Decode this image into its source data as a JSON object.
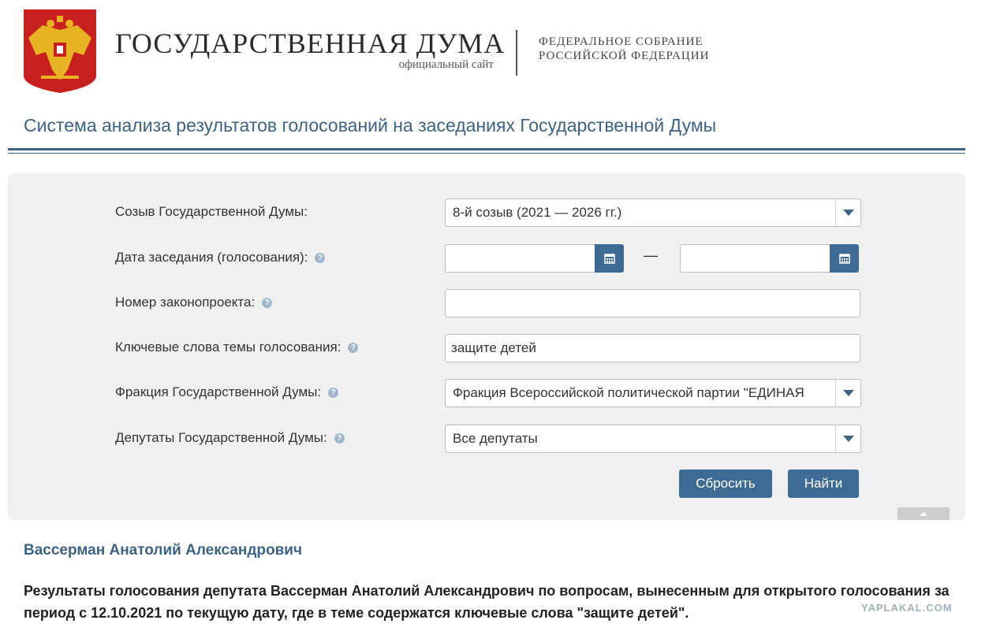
{
  "header": {
    "title": "ГОСУДАРСТВЕННАЯ ДУМА",
    "subtitle": "официальный сайт",
    "federal_line1": "ФЕДЕРАЛЬНОЕ СОБРАНИЕ",
    "federal_line2": "РОССИЙСКОЙ ФЕДЕРАЦИИ",
    "emblem_icon": "coat-of-arms-icon",
    "colors": {
      "emblem_red": "#c8201f",
      "eagle_gold": "#e6b422",
      "accent_blue": "#3e6383",
      "button_blue": "#3e6b94"
    }
  },
  "system_title": "Система анализа результатов голосований на заседаниях Государственной Думы",
  "form": {
    "convocation": {
      "label": "Созыв Государственной Думы:",
      "value": "8-й созыв (2021 — 2026 гг.)"
    },
    "session_date": {
      "label": "Дата заседания (голосования):",
      "from": "",
      "to": "",
      "separator": "—"
    },
    "bill_number": {
      "label": "Номер законопроекта:",
      "value": ""
    },
    "keywords": {
      "label": "Ключевые слова темы голосования:",
      "value": "защите детей"
    },
    "faction": {
      "label": "Фракция Государственной Думы:",
      "value": "Фракция Всероссийской политической партии \"ЕДИНАЯ"
    },
    "deputies": {
      "label": "Депутаты Государственной Думы:",
      "value": "Все депутаты"
    },
    "help_glyph": "?",
    "reset_label": "Сбросить",
    "search_label": "Найти"
  },
  "results": {
    "deputy_name": "Вассерман Анатолий Александрович",
    "summary": "Результаты голосования депутата Вассерман Анатолий Александрович по вопросам, вынесенным для открытого голосования за период с 12.10.2021 по текущую дату, где в теме содержатся ключевые слова \"защите детей\"."
  },
  "watermark": "YAPLAKAL.COM"
}
